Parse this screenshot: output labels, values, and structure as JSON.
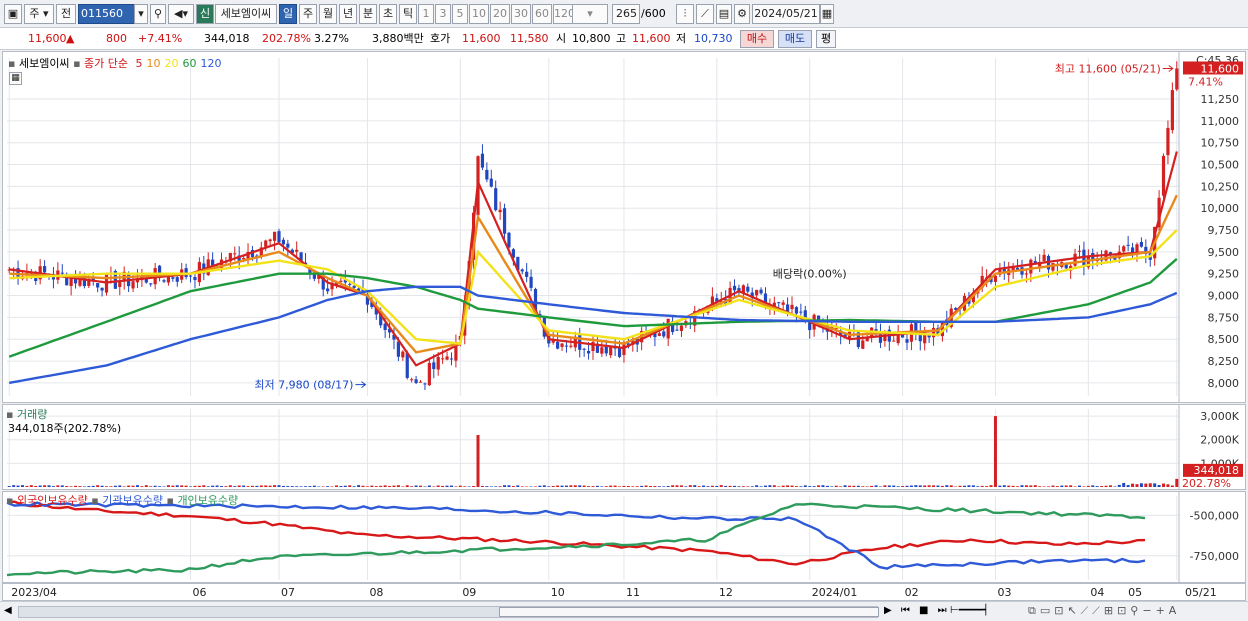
{
  "toolbar": {
    "market": "주",
    "prev": "전",
    "code": "011560",
    "new_badge": "신",
    "stock_name": "세보엠이씨",
    "periods": [
      "일",
      "주",
      "월",
      "년",
      "분",
      "초",
      "틱"
    ],
    "active_period": "일",
    "intervals": [
      "1",
      "3",
      "5",
      "10",
      "20",
      "30",
      "60",
      "120"
    ],
    "count": "265",
    "count_total": "/600",
    "date": "2024/05/21"
  },
  "quote": {
    "price": "11,600",
    "change_arrow": "▲",
    "change": "800",
    "change_pct": "+7.41%",
    "volume": "344,018",
    "vol_ratio": "202.78%",
    "turnover_pct": "3.27%",
    "amount": "3,880백만",
    "ask_label": "호가",
    "ask": "11,600",
    "bid": "11,580",
    "open_label": "시",
    "open": "10,800",
    "high_label": "고",
    "high": "11,600",
    "low_label": "저",
    "low": "10,730",
    "buy_button": "매수",
    "sell_button": "매도",
    "eval_button": "평"
  },
  "legend": {
    "name": "세보엠이씨",
    "ma_label": "종가 단순",
    "ma_periods": [
      "5",
      "10",
      "20",
      "60",
      "120"
    ],
    "ma_colors": [
      "#d42020",
      "#e88a1a",
      "#f2e21a",
      "#1f9a3c",
      "#2e5ad8"
    ]
  },
  "annotations": {
    "high_text": "최고 11,600 (05/21)",
    "low_text": "최저 7,980 (08/17)",
    "dividend_text": "배당락(0.00%)",
    "top_right_label": "C:45.36",
    "current_price_box": "11,600",
    "current_pct_box": "7.41%"
  },
  "volume_panel": {
    "title": "거래량",
    "subtitle": "344,018주(202.78%)",
    "current_box": "344,018",
    "current_pct": "202.78%",
    "ticks": [
      "3,000K",
      "2,000K",
      "1,000K"
    ]
  },
  "holding_panel": {
    "series_labels": [
      "외국인보유수량",
      "기관보유수량",
      "개인보유수량"
    ],
    "series_colors": [
      "#d81818",
      "#2e5ad8",
      "#2e9a5c"
    ],
    "ticks": [
      "-500,000",
      "-750,000"
    ]
  },
  "x_axis_labels": [
    "2023/04",
    "06",
    "07",
    "08",
    "09",
    "10",
    "11",
    "12",
    "2024/01",
    "02",
    "03",
    "04",
    "05",
    "05/21"
  ],
  "chart_data": [
    {
      "type": "candlestick",
      "title": "세보엠이씨",
      "y_ticks": [
        8000,
        8250,
        8500,
        8750,
        9000,
        9250,
        9500,
        9750,
        10000,
        10250,
        10500,
        10750,
        11000,
        11250
      ],
      "ylim": [
        7850,
        11720
      ],
      "x_labels": [
        "2023/04",
        "06",
        "07",
        "08",
        "09",
        "10",
        "11",
        "12",
        "2024/01",
        "02",
        "03",
        "04",
        "05"
      ],
      "points": [
        {
          "date": "2023/04",
          "close": 9300
        },
        {
          "date": "05",
          "close": 9150
        },
        {
          "date": "06",
          "close": 9250
        },
        {
          "date": "07",
          "close": 9650
        },
        {
          "date": "07 mid",
          "close": 9100
        },
        {
          "date": "08",
          "close": 9000
        },
        {
          "date": "08/17",
          "close": 7980
        },
        {
          "date": "09",
          "close": 8450
        },
        {
          "date": "09 peak",
          "close": 10550
        },
        {
          "date": "10",
          "close": 8500
        },
        {
          "date": "11",
          "close": 8400
        },
        {
          "date": "12",
          "close": 9050
        },
        {
          "date": "2024/01",
          "close": 8500
        },
        {
          "date": "02",
          "close": 8600
        },
        {
          "date": "03",
          "close": 9300
        },
        {
          "date": "04",
          "close": 9450
        },
        {
          "date": "05",
          "close": 9500
        },
        {
          "date": "05/21",
          "close": 11600
        }
      ],
      "ma": [
        {
          "name": "5",
          "values": [
            9300,
            9150,
            9250,
            9600,
            9150,
            9000,
            8200,
            8450,
            10300,
            8500,
            8400,
            9050,
            8500,
            8600,
            9300,
            9450,
            9500,
            10650
          ]
        },
        {
          "name": "10",
          "values": [
            9250,
            9200,
            9250,
            9500,
            9200,
            9000,
            8350,
            8450,
            9900,
            8550,
            8450,
            9000,
            8550,
            8600,
            9250,
            9400,
            9500,
            10150
          ]
        },
        {
          "name": "20",
          "values": [
            9200,
            9250,
            9250,
            9400,
            9300,
            9050,
            8500,
            8450,
            9500,
            8600,
            8500,
            8950,
            8600,
            8550,
            9100,
            9350,
            9450,
            9750
          ]
        },
        {
          "name": "60",
          "values": [
            8300,
            8700,
            9050,
            9250,
            9250,
            9200,
            9100,
            8950,
            8850,
            8750,
            8650,
            8700,
            8720,
            8700,
            8700,
            8900,
            9150,
            9420
          ]
        },
        {
          "name": "120",
          "values": [
            8000,
            8200,
            8500,
            8750,
            8950,
            9050,
            9100,
            9100,
            9000,
            8900,
            8800,
            8720,
            8700,
            8700,
            8700,
            8750,
            8900,
            9030
          ]
        }
      ],
      "high_label": "최고 11,600 (05/21)",
      "low_label": "최저 7,980 (08/17)"
    },
    {
      "type": "bar",
      "title": "거래량",
      "y_ticks": [
        1000000,
        2000000,
        3000000
      ],
      "ylim": [
        0,
        3300000
      ],
      "spikes": [
        {
          "date": "09 peak",
          "value": 2200000
        },
        {
          "date": "02",
          "value": 3000000
        },
        {
          "date": "05/21",
          "value": 344018
        }
      ]
    },
    {
      "type": "line",
      "y_ticks": [
        -500000,
        -750000
      ],
      "series": [
        {
          "name": "외국인보유수량",
          "values": [
            -420000,
            -470000,
            -500000,
            -550000,
            -620000,
            -640000,
            -660000,
            -690000,
            -720000,
            -800000,
            -700000,
            -650000,
            -680000,
            -660000
          ]
        },
        {
          "name": "기관보유수량",
          "values": [
            -430000,
            -435000,
            -440000,
            -445000,
            -450000,
            -460000,
            -480000,
            -500000,
            -520000,
            -520000,
            -820000,
            -800000,
            -780000,
            -780000
          ]
        },
        {
          "name": "개인보유수량",
          "values": [
            -860000,
            -850000,
            -840000,
            -760000,
            -740000,
            -720000,
            -700000,
            -680000,
            -650000,
            -430000,
            -450000,
            -470000,
            -490000,
            -510000
          ]
        }
      ]
    }
  ]
}
